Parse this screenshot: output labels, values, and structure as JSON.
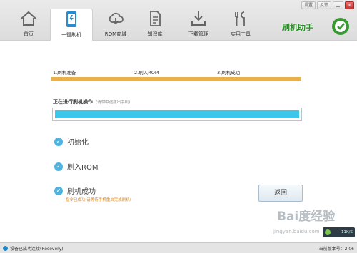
{
  "window": {
    "controls": [
      "设置",
      "反馈",
      "",
      "×"
    ]
  },
  "nav": {
    "items": [
      {
        "label": "首页",
        "icon": "home-icon",
        "active": false
      },
      {
        "label": "一键刷机",
        "icon": "phone-flash-icon",
        "active": true
      },
      {
        "label": "ROM商城",
        "icon": "cloud-download-icon",
        "active": false
      },
      {
        "label": "知识库",
        "icon": "document-icon",
        "active": false
      },
      {
        "label": "下载管理",
        "icon": "download-icon",
        "active": false
      },
      {
        "label": "实用工具",
        "icon": "tools-icon",
        "active": false
      }
    ]
  },
  "brand": {
    "text": "刷机助手"
  },
  "steps": [
    {
      "label": "1.刷机准备"
    },
    {
      "label": "2.刷入ROM"
    },
    {
      "label": "3.刷机成功"
    }
  ],
  "progress": {
    "title": "正在进行刷机操作",
    "hint": "(请勿中途拔出手机)",
    "fraction": 1.0
  },
  "status_items": [
    {
      "label": "初始化"
    },
    {
      "label": "刷入ROM"
    },
    {
      "label": "刷机成功"
    }
  ],
  "warning": "指令已成功,请等待手机重启完成刷机!",
  "back_button": "返回",
  "statusbar": {
    "device": "设备已成功连接(Recovery)",
    "version": "当前版本号：2.06"
  },
  "speed": {
    "value": "11K/S"
  },
  "watermark": {
    "brand": "Bai度经验",
    "url": "jingyan.baidu.com"
  }
}
